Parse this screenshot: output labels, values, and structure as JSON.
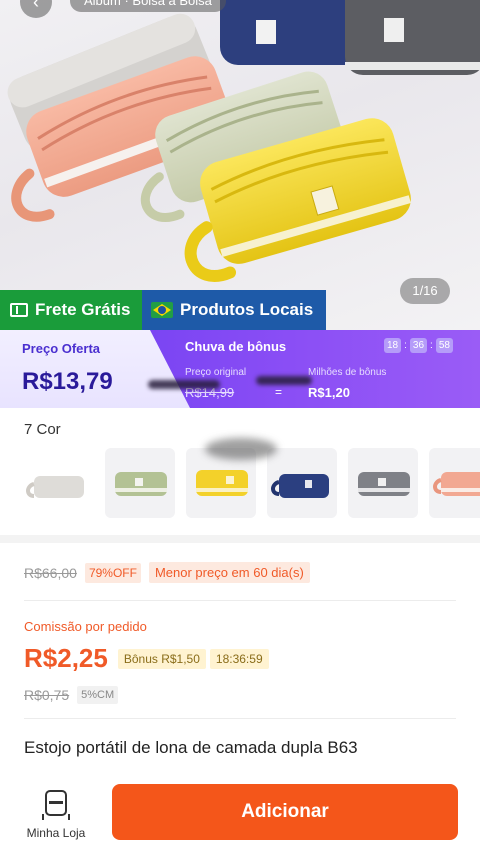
{
  "header": {
    "back_icon": "back-arrow-icon",
    "breadcrumb": "Álbum · Bolsa a Bolsa"
  },
  "gallery": {
    "counter": "1/16",
    "bag_colors": [
      "#c9c7c4",
      "#f2a48c",
      "#ccd3b7",
      "#f1d323",
      "#2c3f7d",
      "#57585c"
    ]
  },
  "tags": {
    "frete": {
      "label": "Frete Grátis",
      "icon": "truck-box-icon",
      "color": "#1a9c3a"
    },
    "local": {
      "label": "Produtos Locais",
      "icon": "brazil-flag-icon",
      "color": "#1e5aa8"
    }
  },
  "promo": {
    "offer_label": "Preço Oferta",
    "offer_price": "R$13,79",
    "rain_title": "Chuva de bônus",
    "timer": [
      "18",
      "36",
      "58"
    ],
    "orig_label": "Preço original",
    "orig_value": "R$14,99",
    "bonus_label": "Milhões de bônus",
    "bonus_value": "R$1,20",
    "accent": "#6a3bf0"
  },
  "variants": {
    "label": "7 Cor",
    "colors": [
      "#d9d7d3",
      "#b7c49a",
      "#f3d12a",
      "#2b3f80",
      "#7f8187",
      "#f2a892"
    ]
  },
  "pricing": {
    "old_price": "R$66,00",
    "discount": "79%OFF",
    "lowest": "Menor preço em 60 dia(s)",
    "commission_label": "Comissão por pedido",
    "commission_value": "R$2,25",
    "bonus_chip": "Bônus R$1,50",
    "bonus_time": "18:36:59",
    "cm_old": "R$0,75",
    "cm_percent": "5%CM"
  },
  "product": {
    "title": "Estojo portátil de lona de camada dupla  B63"
  },
  "bottom_bar": {
    "shop_label": "Minha Loja",
    "shop_icon": "store-icon",
    "add_label": "Adicionar",
    "add_color": "#f4561a"
  }
}
